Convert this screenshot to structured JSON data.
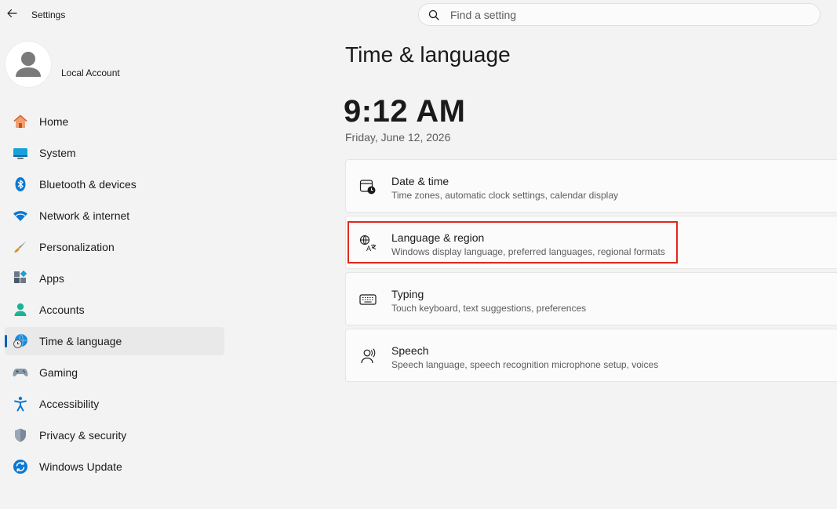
{
  "window": {
    "title": "Settings"
  },
  "search": {
    "placeholder": "Find a setting"
  },
  "account": {
    "name": "Local Account"
  },
  "sidebar": {
    "items": [
      {
        "label": "Home",
        "icon": "home-icon"
      },
      {
        "label": "System",
        "icon": "system-icon"
      },
      {
        "label": "Bluetooth & devices",
        "icon": "bluetooth-icon"
      },
      {
        "label": "Network & internet",
        "icon": "wifi-icon"
      },
      {
        "label": "Personalization",
        "icon": "brush-icon"
      },
      {
        "label": "Apps",
        "icon": "apps-icon"
      },
      {
        "label": "Accounts",
        "icon": "accounts-icon"
      },
      {
        "label": "Time & language",
        "icon": "time-language-icon",
        "active": true
      },
      {
        "label": "Gaming",
        "icon": "gamepad-icon"
      },
      {
        "label": "Accessibility",
        "icon": "accessibility-icon"
      },
      {
        "label": "Privacy & security",
        "icon": "shield-icon"
      },
      {
        "label": "Windows Update",
        "icon": "update-icon"
      }
    ]
  },
  "main": {
    "title": "Time & language",
    "clock": {
      "time": "9:12 AM",
      "date": "Friday, June 12, 2026"
    },
    "cards": [
      {
        "title": "Date & time",
        "description": "Time zones, automatic clock settings, calendar display",
        "icon": "calendar-clock-icon"
      },
      {
        "title": "Language & region",
        "description": "Windows display language, preferred languages, regional formats",
        "icon": "language-icon",
        "highlighted": true
      },
      {
        "title": "Typing",
        "description": "Touch keyboard, text suggestions, preferences",
        "icon": "keyboard-icon"
      },
      {
        "title": "Speech",
        "description": "Speech language, speech recognition microphone setup, voices",
        "icon": "speech-icon"
      }
    ]
  },
  "colors": {
    "accent": "#005fb8",
    "highlight": "#e2261c",
    "background": "#f3f3f3"
  }
}
